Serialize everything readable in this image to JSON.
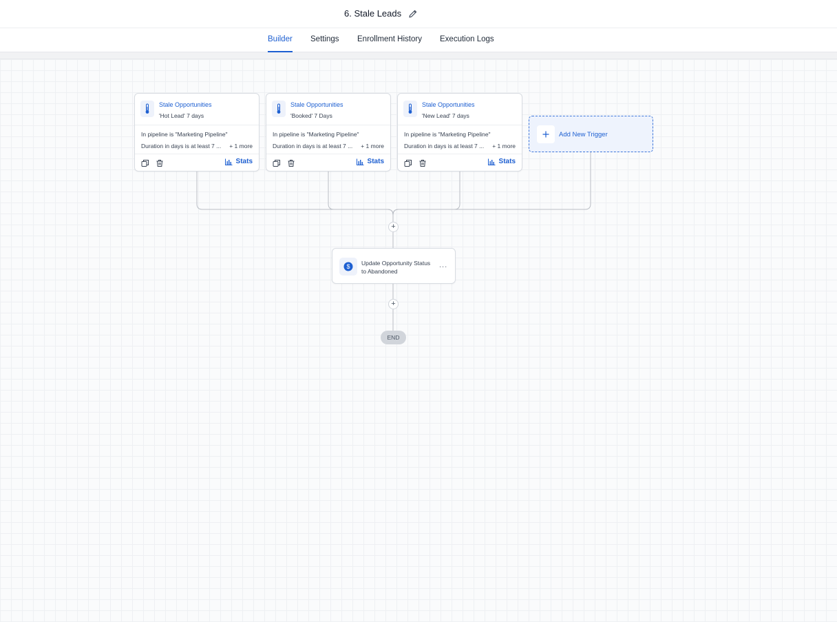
{
  "header": {
    "title": "6. Stale Leads"
  },
  "tabs": [
    {
      "label": "Builder",
      "active": true
    },
    {
      "label": "Settings",
      "active": false
    },
    {
      "label": "Enrollment History",
      "active": false
    },
    {
      "label": "Execution Logs",
      "active": false
    }
  ],
  "triggers": [
    {
      "title": "Stale Opportunities",
      "subtitle": "'Hot Lead' 7 days",
      "line1": "In pipeline is \"Marketing Pipeline\"",
      "line2": "Duration in days is at least 7 ...",
      "more": "+ 1 more",
      "stats": "Stats",
      "icon": "thermometer-icon"
    },
    {
      "title": "Stale Opportunities",
      "subtitle": "'Booked' 7 Days",
      "line1": "In pipeline is \"Marketing Pipeline\"",
      "line2": "Duration in days is at least 7 ...",
      "more": "+ 1 more",
      "stats": "Stats",
      "icon": "thermometer-icon"
    },
    {
      "title": "Stale Opportunities",
      "subtitle": "'New Lead' 7 days",
      "line1": "In pipeline is \"Marketing Pipeline\"",
      "line2": "Duration in days is at least 7 ...",
      "more": "+ 1 more",
      "stats": "Stats",
      "icon": "thermometer-icon"
    }
  ],
  "add_trigger": {
    "label": "Add New Trigger",
    "icon": "plus-icon"
  },
  "action": {
    "line1": "Update Opportunity Status",
    "line2": "to Abandoned",
    "menu": "...",
    "icon": "dollar-icon"
  },
  "plus_glyph": "+",
  "end": {
    "label": "END"
  },
  "colors": {
    "accent": "#1d5fd1",
    "border": "#d8dce2",
    "connector": "#b9bdc4",
    "end_pill": "#d1d5db"
  }
}
